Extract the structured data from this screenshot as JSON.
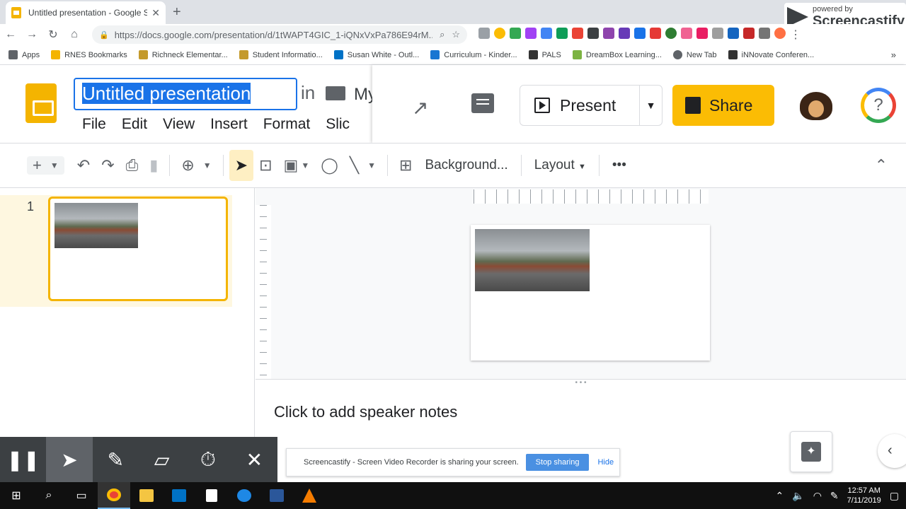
{
  "browser": {
    "tab_title": "Untitled presentation - Google Sl",
    "url": "https://docs.google.com/presentation/d/1tWAPT4GIC_1-iQNxVxPa786E94rM...",
    "bookmarks": [
      "Apps",
      "RNES Bookmarks",
      "Richneck Elementar...",
      "Student Informatio...",
      "Susan White - Outl...",
      "Curriculum - Kinder...",
      "PALS",
      "DreamBox Learning...",
      "New Tab",
      "iNNovate Conferen..."
    ]
  },
  "watermark": {
    "line1": "powered by",
    "line2": "Screencastify"
  },
  "doc": {
    "title": "Untitled presentation",
    "in_label": "in",
    "folder": "My"
  },
  "menu": [
    "File",
    "Edit",
    "View",
    "Insert",
    "Format",
    "Slic"
  ],
  "header": {
    "present_label": "Present",
    "share_label": "Share",
    "help_label": "?"
  },
  "toolbar": {
    "background_label": "Background...",
    "layout_label": "Layout",
    "more_label": "•••"
  },
  "filmstrip": {
    "slide_number": "1"
  },
  "notes": {
    "placeholder": "Click to add speaker notes"
  },
  "screencastify": {
    "notice": "Screencastify - Screen Video Recorder is sharing your screen.",
    "stop_label": "Stop sharing",
    "hide_label": "Hide"
  },
  "taskbar": {
    "time": "12:57 AM",
    "date": "7/11/2019"
  },
  "colors": {
    "accent": "#1a73e8",
    "share": "#fbbc04",
    "slides_brand": "#f4b400"
  }
}
